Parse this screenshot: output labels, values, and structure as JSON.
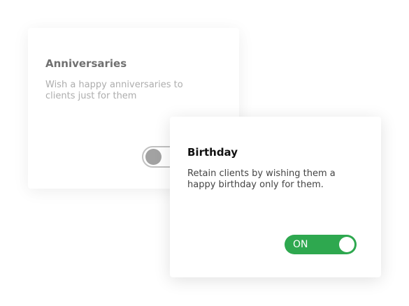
{
  "cards": [
    {
      "title": "Anniversaries",
      "description": "Wish a happy anniversaries to clients just for them",
      "toggle": {
        "state": "off"
      }
    },
    {
      "title": "Birthday",
      "description": "Retain clients by wishing them a happy birthday only for them.",
      "toggle": {
        "state": "on",
        "label": "ON"
      }
    }
  ],
  "colors": {
    "toggle_on": "#2ea84f",
    "toggle_off_knob": "#666666"
  }
}
